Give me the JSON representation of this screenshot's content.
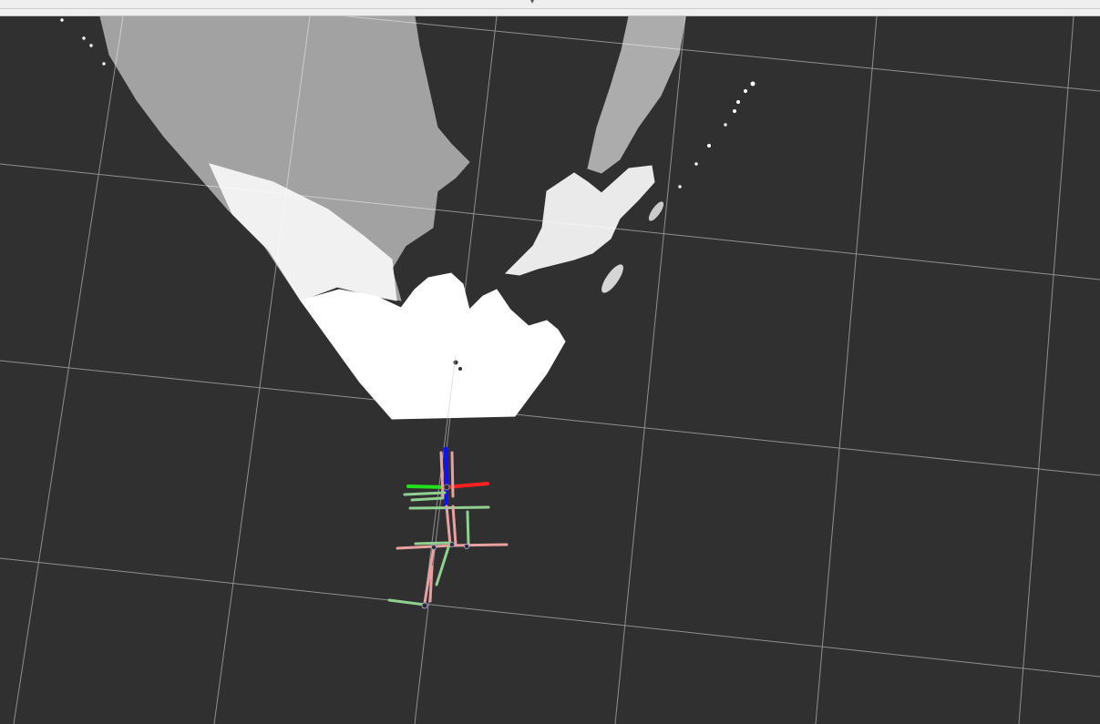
{
  "viewport": {
    "background_color": "#303030",
    "grid_color": "#a0a0a0",
    "point_cloud_color": "#ffffff",
    "axis_colors": {
      "x": "#ff2020",
      "y": "#20e020",
      "z": "#1010ff"
    },
    "tf_link_colors": {
      "x": "#e8a0a0",
      "y": "#90d090"
    }
  },
  "splitter": {
    "icon": "grip-handle-icon"
  }
}
